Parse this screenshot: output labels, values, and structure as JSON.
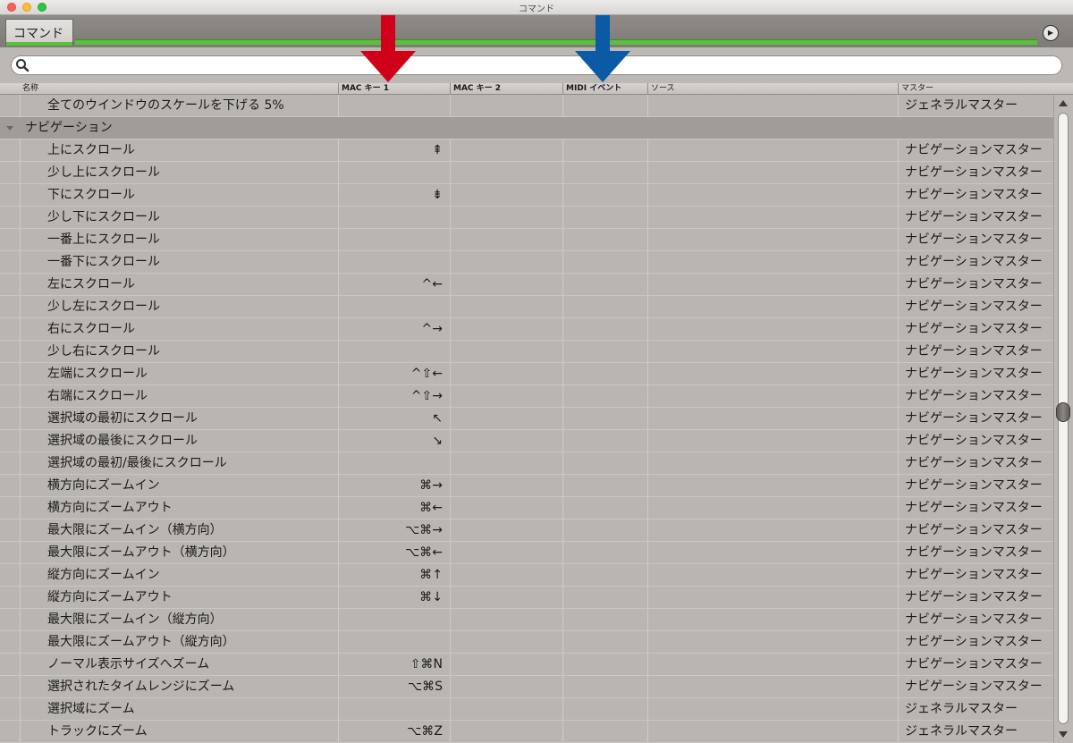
{
  "window": {
    "title": "コマンド"
  },
  "tabs": [
    {
      "label": "コマンド"
    }
  ],
  "search": {
    "placeholder": "",
    "value": ""
  },
  "columns": [
    "名称",
    "MAC キー 1",
    "MAC キー 2",
    "MIDI イベント",
    "ソース",
    "マスター"
  ],
  "colors": {
    "red_arrow": "#d0001b",
    "blue_arrow": "#0b5aa5",
    "accent_green": "#58c23a"
  },
  "rows": [
    {
      "type": "item",
      "name": "全てのウインドウのスケールを下げる 5%",
      "mac1": "",
      "master": "ジェネラルマスター"
    },
    {
      "type": "category",
      "name": "ナビゲーション"
    },
    {
      "type": "item",
      "name": "上にスクロール",
      "mac1": "⇞",
      "master": "ナビゲーションマスター"
    },
    {
      "type": "item",
      "name": "少し上にスクロール",
      "mac1": "",
      "master": "ナビゲーションマスター"
    },
    {
      "type": "item",
      "name": "下にスクロール",
      "mac1": "⇟",
      "master": "ナビゲーションマスター"
    },
    {
      "type": "item",
      "name": "少し下にスクロール",
      "mac1": "",
      "master": "ナビゲーションマスター"
    },
    {
      "type": "item",
      "name": "一番上にスクロール",
      "mac1": "",
      "master": "ナビゲーションマスター"
    },
    {
      "type": "item",
      "name": "一番下にスクロール",
      "mac1": "",
      "master": "ナビゲーションマスター"
    },
    {
      "type": "item",
      "name": "左にスクロール",
      "mac1": "^←",
      "master": "ナビゲーションマスター"
    },
    {
      "type": "item",
      "name": "少し左にスクロール",
      "mac1": "",
      "master": "ナビゲーションマスター"
    },
    {
      "type": "item",
      "name": "右にスクロール",
      "mac1": "^→",
      "master": "ナビゲーションマスター"
    },
    {
      "type": "item",
      "name": "少し右にスクロール",
      "mac1": "",
      "master": "ナビゲーションマスター"
    },
    {
      "type": "item",
      "name": "左端にスクロール",
      "mac1": "^⇧←",
      "master": "ナビゲーションマスター"
    },
    {
      "type": "item",
      "name": "右端にスクロール",
      "mac1": "^⇧→",
      "master": "ナビゲーションマスター"
    },
    {
      "type": "item",
      "name": "選択域の最初にスクロール",
      "mac1": "↖",
      "master": "ナビゲーションマスター"
    },
    {
      "type": "item",
      "name": "選択域の最後にスクロール",
      "mac1": "↘",
      "master": "ナビゲーションマスター"
    },
    {
      "type": "item",
      "name": "選択域の最初/最後にスクロール",
      "mac1": "",
      "master": "ナビゲーションマスター"
    },
    {
      "type": "item",
      "name": "横方向にズームイン",
      "mac1": "⌘→",
      "master": "ナビゲーションマスター"
    },
    {
      "type": "item",
      "name": "横方向にズームアウト",
      "mac1": "⌘←",
      "master": "ナビゲーションマスター"
    },
    {
      "type": "item",
      "name": "最大限にズームイン（横方向）",
      "mac1": "⌥⌘→",
      "master": "ナビゲーションマスター"
    },
    {
      "type": "item",
      "name": "最大限にズームアウト（横方向）",
      "mac1": "⌥⌘←",
      "master": "ナビゲーションマスター"
    },
    {
      "type": "item",
      "name": "縦方向にズームイン",
      "mac1": "⌘↑",
      "master": "ナビゲーションマスター"
    },
    {
      "type": "item",
      "name": "縦方向にズームアウト",
      "mac1": "⌘↓",
      "master": "ナビゲーションマスター"
    },
    {
      "type": "item",
      "name": "最大限にズームイン（縦方向）",
      "mac1": "",
      "master": "ナビゲーションマスター"
    },
    {
      "type": "item",
      "name": "最大限にズームアウト（縦方向）",
      "mac1": "",
      "master": "ナビゲーションマスター"
    },
    {
      "type": "item",
      "name": "ノーマル表示サイズへズーム",
      "mac1": "⇧⌘N",
      "master": "ナビゲーションマスター"
    },
    {
      "type": "item",
      "name": "選択されたタイムレンジにズーム",
      "mac1": "⌥⌘S",
      "master": "ナビゲーションマスター"
    },
    {
      "type": "item",
      "name": "選択域にズーム",
      "mac1": "",
      "master": "ジェネラルマスター"
    },
    {
      "type": "item",
      "name": "トラックにズーム",
      "mac1": "⌥⌘Z",
      "master": "ジェネラルマスター"
    }
  ]
}
